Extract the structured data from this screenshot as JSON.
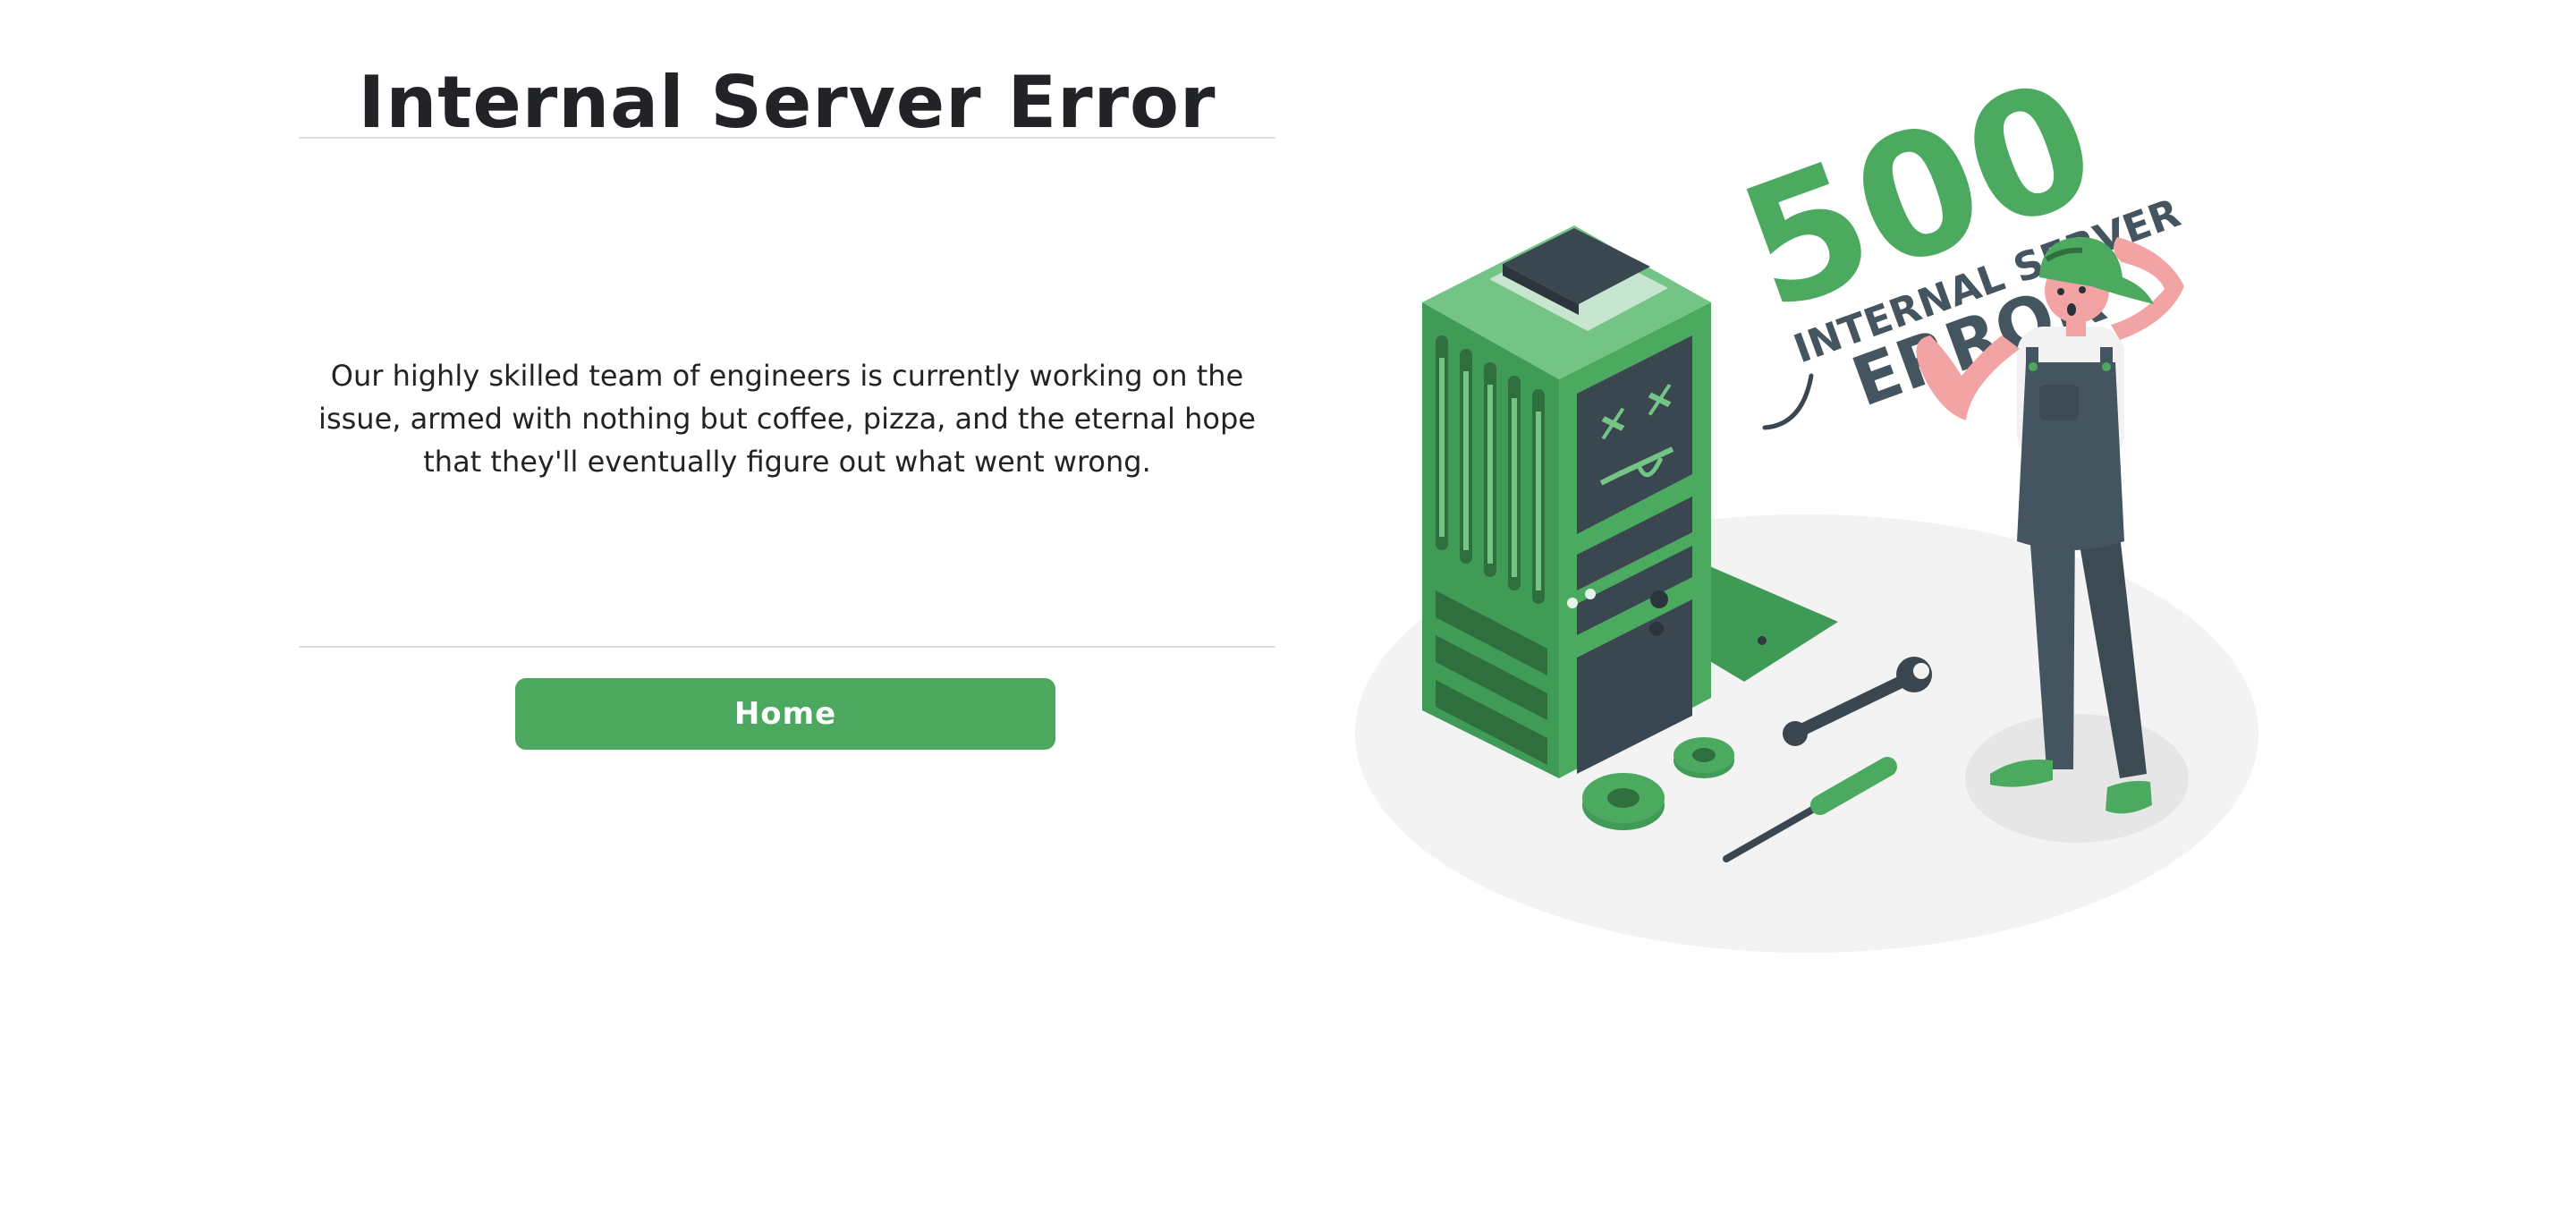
{
  "page": {
    "title": "Internal Server Error",
    "message": "Our highly skilled team of engineers is currently working on the issue, armed with nothing but coffee, pizza, and the eternal hope that they'll eventually figure out what went wrong.",
    "home_button_label": "Home"
  },
  "illustration": {
    "code": "500",
    "line1": "INTERNAL SERVER",
    "line2": "ERROR"
  },
  "colors": {
    "accent": "#4ca85f",
    "text": "#222326",
    "dark_slate": "#455560"
  }
}
